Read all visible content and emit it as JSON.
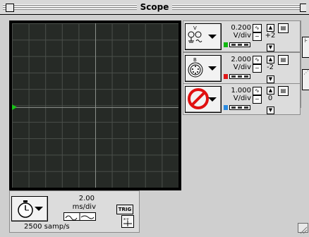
{
  "window": {
    "title": "Scope"
  },
  "channels": [
    {
      "value": "0.200",
      "unit": "V/div",
      "offset": "+2",
      "color": "#10b810",
      "icon": "probe-icon",
      "enabled": true
    },
    {
      "value": "2.000",
      "unit": "V/div",
      "offset": "-2",
      "color": "#e01818",
      "icon": "din-connector-icon",
      "enabled": true
    },
    {
      "value": "1.000",
      "unit": "V/div",
      "offset": "0",
      "color": "#2a8ae0",
      "icon": "no-symbol-icon",
      "enabled": false
    }
  ],
  "timebase": {
    "value": "2.00",
    "unit": "ms/div",
    "sample_rate": "2500 samp/s",
    "icon": "stopwatch-icon"
  },
  "trigger": {
    "label": "TRIG"
  },
  "xy": {
    "label": "x-y"
  }
}
